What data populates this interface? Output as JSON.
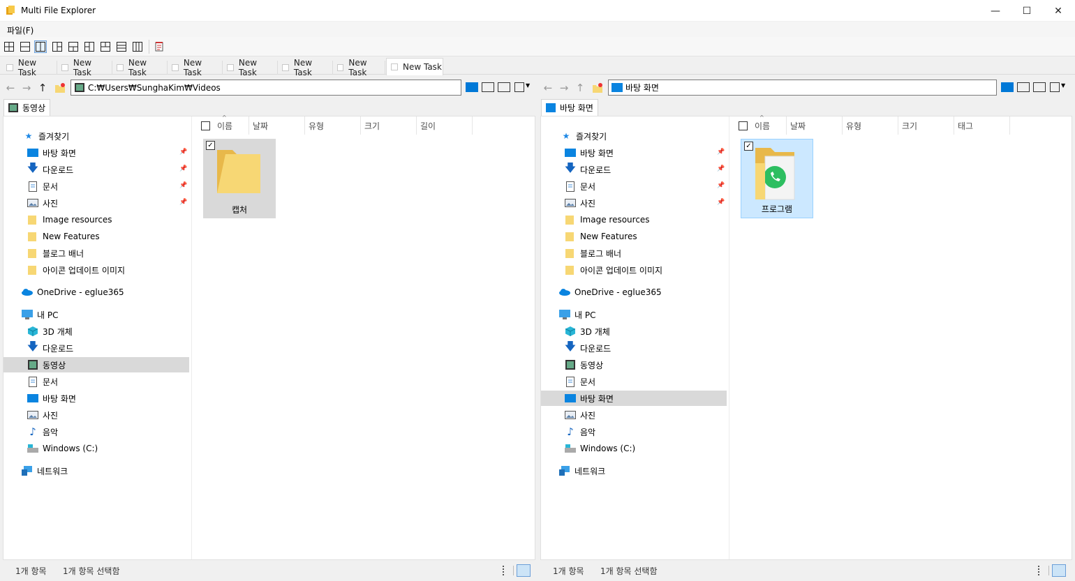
{
  "window": {
    "title": "Multi File Explorer",
    "minimize": "—",
    "maximize": "☐",
    "close": "✕"
  },
  "menu": {
    "file": "파일(F)"
  },
  "tabs": [
    "New Task",
    "New Task",
    "New Task",
    "New Task",
    "New Task",
    "New Task",
    "New Task",
    "New Task"
  ],
  "colors": {
    "accent": "#0078d7",
    "folder": "#f7d774",
    "selected_gray": "#d9d9d9",
    "selected_blue": "#cce8ff"
  },
  "left_pane": {
    "address": "C:₩Users₩SunghaKim₩Videos",
    "location_tab": "동영상",
    "columns": [
      "이름",
      "날짜",
      "유형",
      "크기",
      "길이"
    ],
    "items": [
      {
        "name": "캡처",
        "icon": "folder-icon",
        "checked": true
      }
    ],
    "status_count": "1개 항목",
    "status_selected": "1개 항목 선택함"
  },
  "right_pane": {
    "address": "바탕 화면",
    "location_tab": "바탕 화면",
    "columns": [
      "이름",
      "날짜",
      "유형",
      "크기",
      "태그"
    ],
    "items": [
      {
        "name": "프로그램",
        "icon": "whatsapp-folder-icon",
        "checked": true
      }
    ],
    "status_count": "1개 항목",
    "status_selected": "1개 항목 선택함"
  },
  "tree": {
    "favorites": "즐겨찾기",
    "desktop": "바탕 화면",
    "downloads": "다운로드",
    "documents": "문서",
    "pictures": "사진",
    "image_resources": "Image resources",
    "new_features": "New Features",
    "blog_banner": "블로그 배너",
    "icon_update": "아이콘 업데이트 이미지",
    "onedrive": "OneDrive - eglue365",
    "this_pc": "내 PC",
    "objects3d": "3D 개체",
    "videos": "동영상",
    "music": "음악",
    "windows_c": "Windows  (C:)",
    "network": "네트워크"
  }
}
